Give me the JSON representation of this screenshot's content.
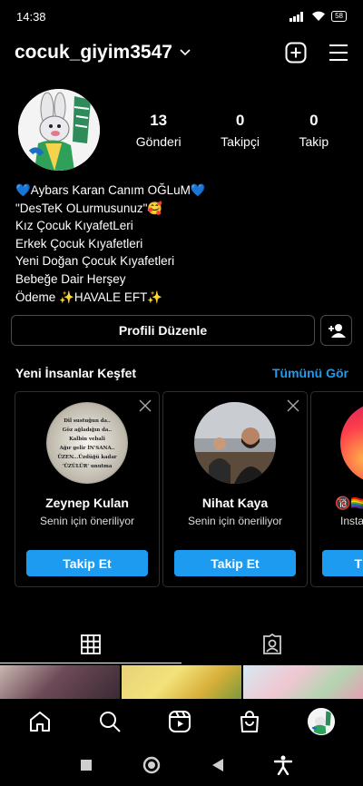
{
  "status": {
    "time": "14:38",
    "battery": "58"
  },
  "header": {
    "username": "cocuk_giyim3547"
  },
  "stats": [
    {
      "count": "13",
      "label": "Gönderi"
    },
    {
      "count": "0",
      "label": "Takipçi"
    },
    {
      "count": "0",
      "label": "Takip"
    }
  ],
  "bio": [
    "💙Aybars Karan Canım OĞLuM💙",
    "\"DesTeK OLurmusunuz\"🥰",
    "Kız Çocuk KıyafetLeri",
    "Erkek Çocuk Kıyafetleri",
    "Yeni Doğan Çocuk Kıyafetleri",
    "Bebeğe Dair Herşey",
    "Ödeme ✨HAVALE EFT✨"
  ],
  "edit_profile_label": "Profili Düzenle",
  "discover": {
    "title": "Yeni İnsanlar Keşfet",
    "see_all": "Tümünü Gör",
    "cards": [
      {
        "name": "Zeynep Kulan",
        "subtitle": "Senin için öneriliyor",
        "button": "Takip Et",
        "avatar_text": "Dil sustuğun da.. Göz ağladığın da.. Kalbin vebali Ağır gelir İN'SANA.. ÜZEN...Üzdüğü kadar 'ÜZÜLÜR' unutma"
      },
      {
        "name": "Nihat Kaya",
        "subtitle": "Senin için öneriliyor",
        "button": "Takip Et"
      },
      {
        "name": "🔞🏳️‍🌈",
        "subtitle": "Insta",
        "button": "T"
      }
    ]
  },
  "icons": {
    "new_post": "plus-square-icon",
    "menu": "hamburger-menu-icon",
    "grid_tab": "grid-icon",
    "tagged_tab": "tagged-person-icon"
  },
  "colors": {
    "accent": "#1d9bf0",
    "background": "#000000"
  }
}
